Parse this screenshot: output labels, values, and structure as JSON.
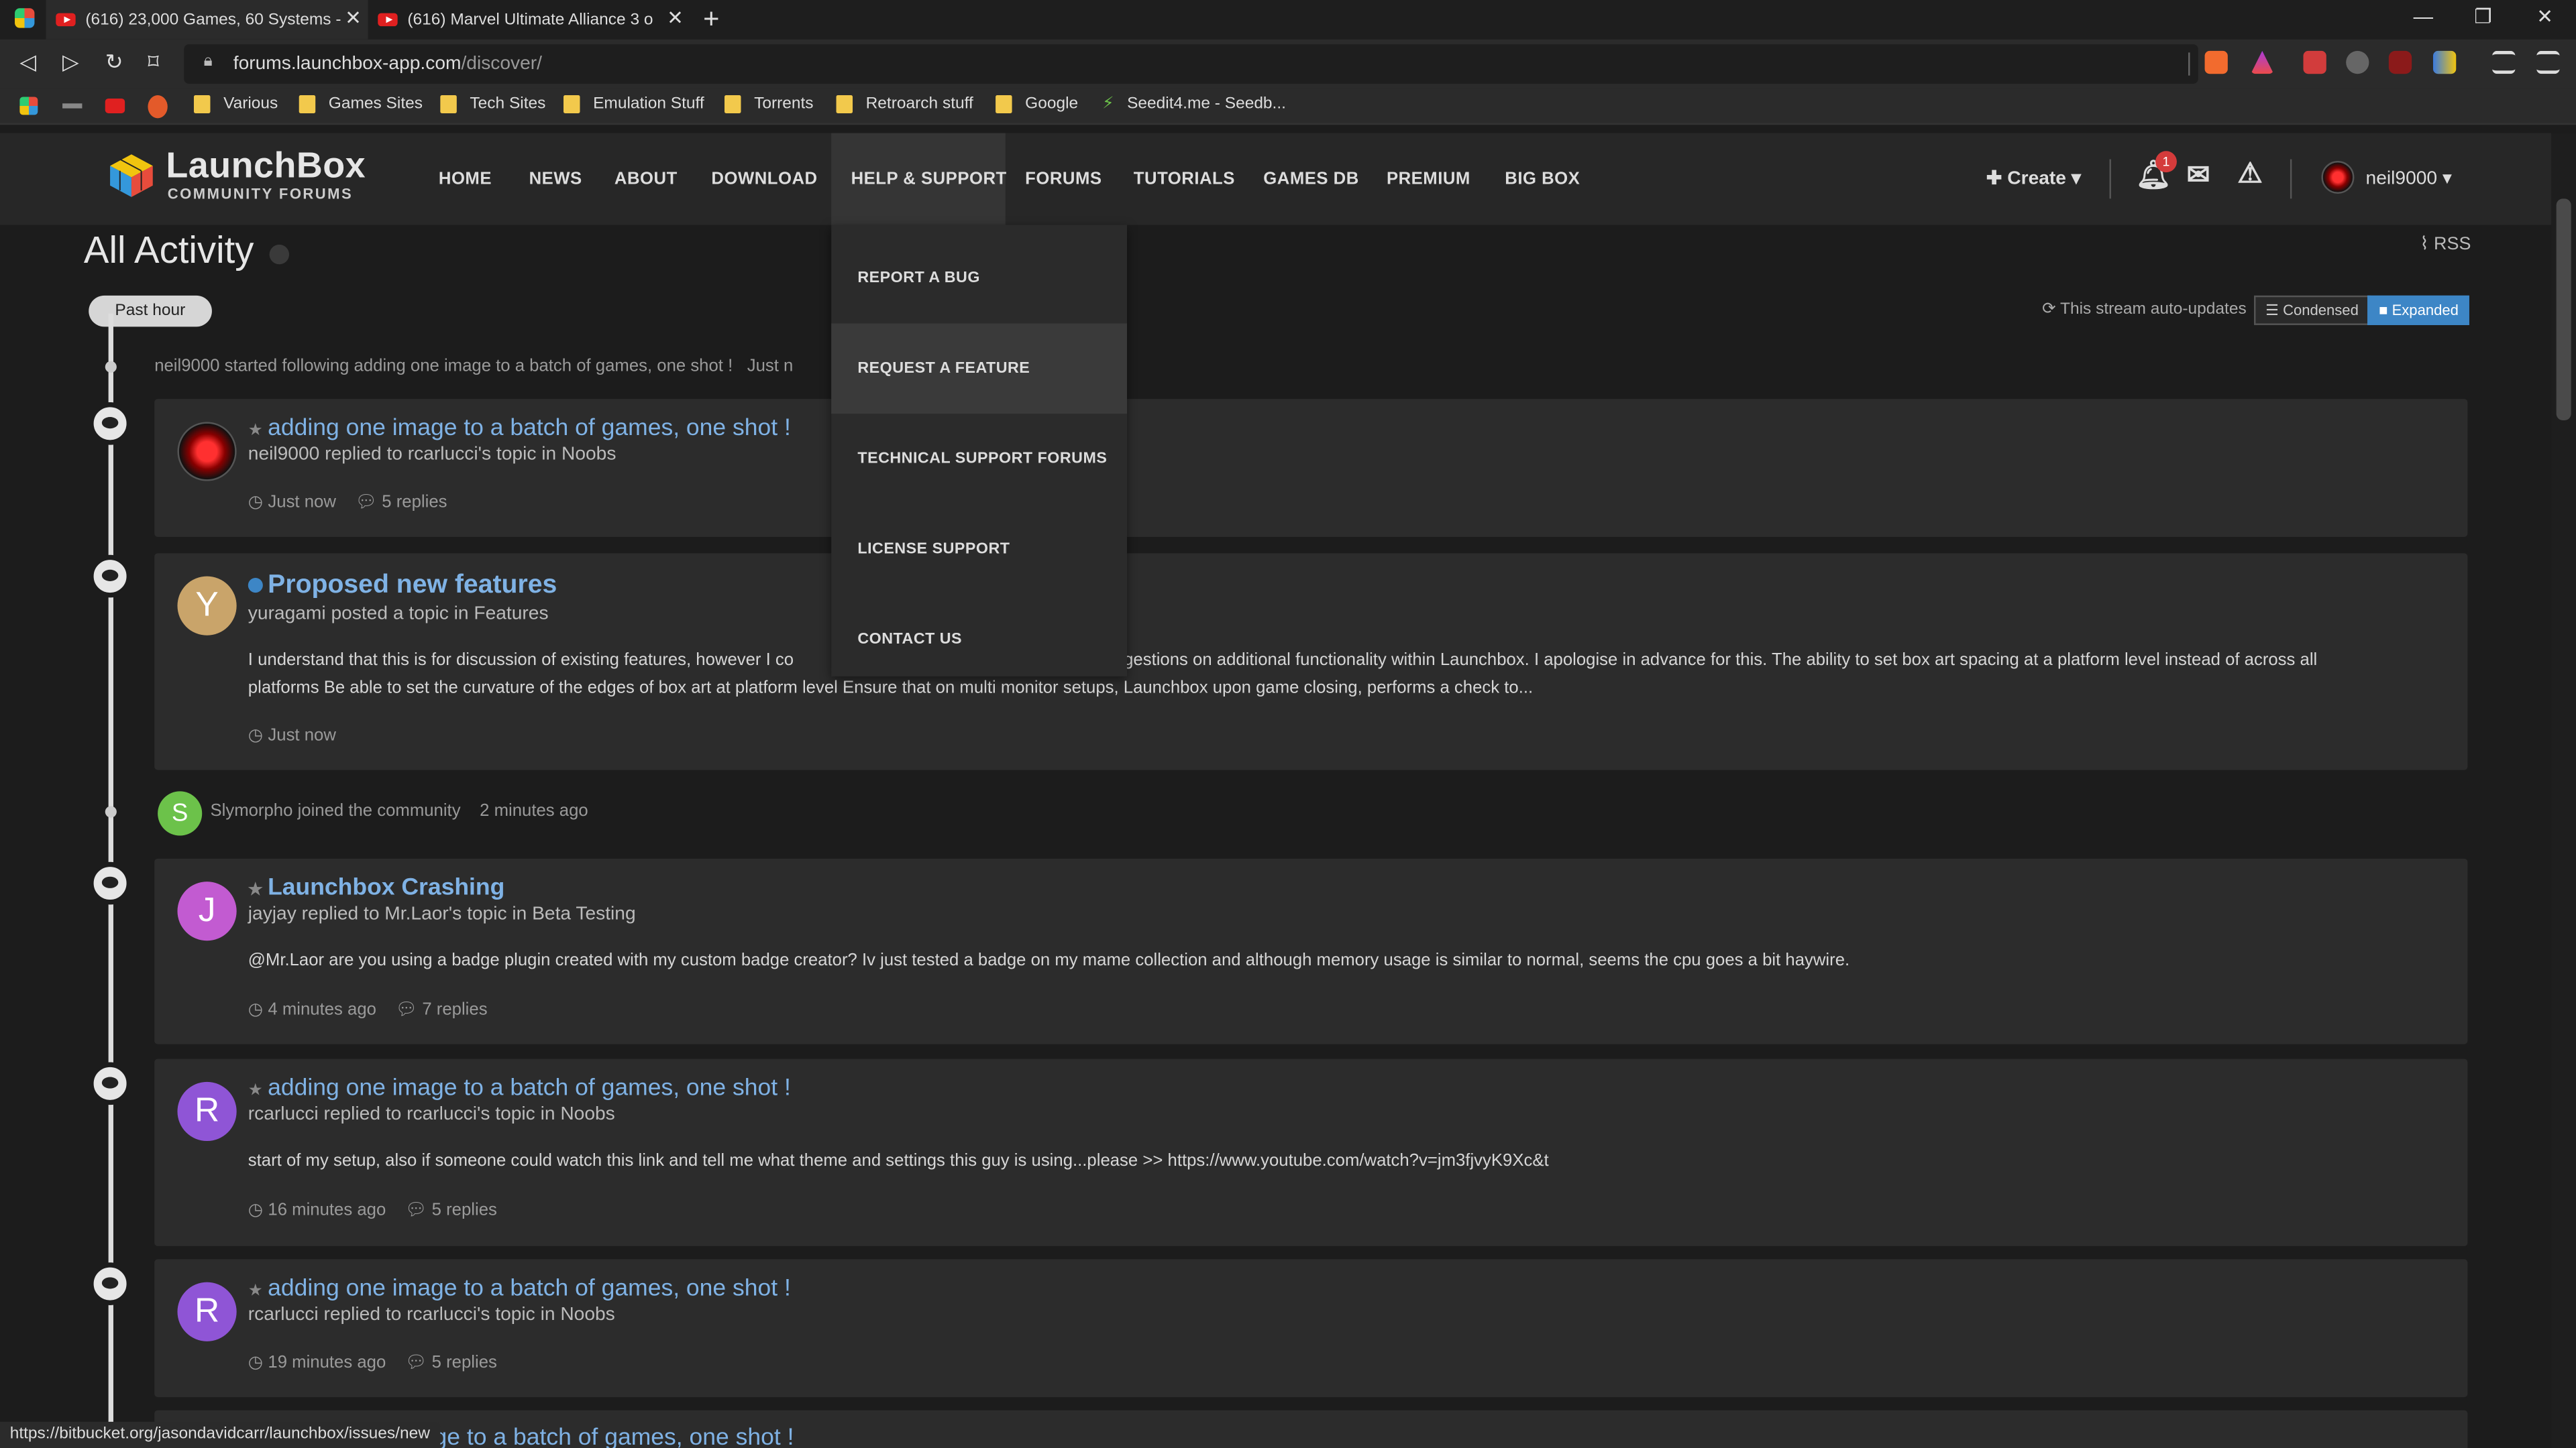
{
  "browser": {
    "tabs": [
      {
        "title": "(616) 23,000 Games, 60 Systems -"
      },
      {
        "title": "(616) Marvel Ultimate Alliance 3 o"
      }
    ],
    "new_tab": "+",
    "url_host": "forums.launchbox-app.com",
    "url_path": "/discover/",
    "bookmarks": [
      "Various",
      "Games Sites",
      "Tech Sites",
      "Emulation Stuff",
      "Torrents",
      "Retroarch stuff",
      "Google",
      "Seedit4.me - Seedb..."
    ]
  },
  "site": {
    "logo_title": "LaunchBox",
    "logo_subtitle": "COMMUNITY FORUMS",
    "nav": [
      "HOME",
      "NEWS",
      "ABOUT",
      "DOWNLOAD",
      "HELP & SUPPORT",
      "FORUMS",
      "TUTORIALS",
      "GAMES DB",
      "PREMIUM",
      "BIG BOX"
    ],
    "create_label": "Create",
    "notification_count": "1",
    "username": "neil9000"
  },
  "dropdown": {
    "items": [
      "REPORT A BUG",
      "REQUEST A FEATURE",
      "TECHNICAL SUPPORT FORUMS",
      "LICENSE SUPPORT",
      "CONTACT US"
    ],
    "highlighted": "REQUEST A FEATURE"
  },
  "stream": {
    "title": "All Activity",
    "rss": "RSS",
    "time_filter": "Past hour",
    "auto_updates": "This stream auto-updates",
    "view_condensed": "Condensed",
    "view_expanded": "Expanded",
    "follow_line": "neil9000 started following adding one image to a batch of games, one shot !",
    "follow_time": "Just n",
    "join_user": "Slymorpho",
    "join_text": "joined the community",
    "join_time": "2 minutes ago",
    "items": [
      {
        "title": "adding one image to a batch of games, one shot !",
        "sub": "neil9000 replied to rcarlucci's topic in Noobs",
        "time": "Just now",
        "replies": "5 replies"
      },
      {
        "title": "Proposed new features",
        "sub": "yuragami posted a topic in Features",
        "avatar": "Y",
        "body1": "I understand that this is for discussion of existing features, however I co",
        "body2": "gestions on additional functionality within Launchbox. I apologise in advance for this. The ability to set box art spacing at a platform level instead of across all",
        "body3": "platforms Be able to set the curvature of the edges of box art at platform level Ensure that on multi monitor setups, Launchbox upon game closing, performs a check to...",
        "time": "Just now"
      },
      {
        "title": "Launchbox Crashing",
        "sub": "jayjay replied to Mr.Laor's topic in Beta Testing",
        "avatar": "J",
        "body": "@Mr.Laor are you using a badge plugin created with my custom badge creator? Iv just tested a badge on my mame collection and although memory usage is similar to normal, seems the cpu goes a bit haywire.",
        "time": "4 minutes ago",
        "replies": "7 replies"
      },
      {
        "title": "adding one image to a batch of games, one shot !",
        "sub": "rcarlucci replied to rcarlucci's topic in Noobs",
        "avatar": "R",
        "body": "start of my setup, also if someone could watch this link and tell me what theme and settings this guy is using...please >> https://www.youtube.com/watch?v=jm3fjvyK9Xc&t",
        "time": "16 minutes ago",
        "replies": "5 replies"
      },
      {
        "title": "adding one image to a batch of games, one shot !",
        "sub": "rcarlucci replied to rcarlucci's topic in Noobs",
        "avatar": "R",
        "time": "19 minutes ago",
        "replies": "5 replies"
      },
      {
        "title": "ge to a batch of games, one shot !"
      }
    ]
  },
  "status_url": "https://bitbucket.org/jasondavidcarr/launchbox/issues/new",
  "colors": {
    "link": "#7fb2e5",
    "accent": "#3d86c6",
    "avatar_y": "#c9a46a",
    "avatar_j": "#c25bd1",
    "avatar_r": "#8f55d6",
    "avatar_s": "#6cc24a"
  }
}
